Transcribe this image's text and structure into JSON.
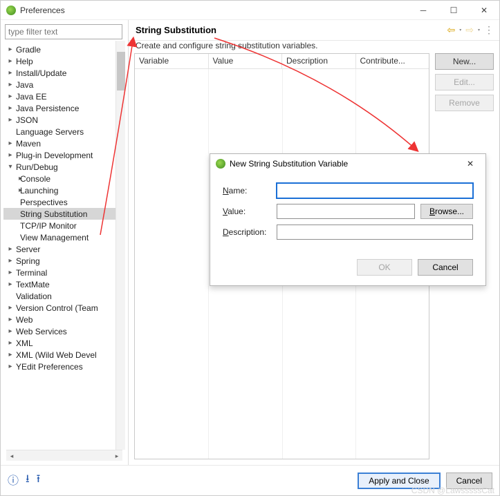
{
  "window": {
    "title": "Preferences"
  },
  "filter_placeholder": "type filter text",
  "tree": [
    {
      "label": "Gradle",
      "lvl": 0,
      "caret": "closed"
    },
    {
      "label": "Help",
      "lvl": 0,
      "caret": "closed"
    },
    {
      "label": "Install/Update",
      "lvl": 0,
      "caret": "closed"
    },
    {
      "label": "Java",
      "lvl": 0,
      "caret": "closed"
    },
    {
      "label": "Java EE",
      "lvl": 0,
      "caret": "closed"
    },
    {
      "label": "Java Persistence",
      "lvl": 0,
      "caret": "closed"
    },
    {
      "label": "JSON",
      "lvl": 0,
      "caret": "closed"
    },
    {
      "label": "Language Servers",
      "lvl": 0,
      "caret": "none"
    },
    {
      "label": "Maven",
      "lvl": 0,
      "caret": "closed"
    },
    {
      "label": "Plug-in Development",
      "lvl": 0,
      "caret": "closed"
    },
    {
      "label": "Run/Debug",
      "lvl": 0,
      "caret": "open"
    },
    {
      "label": "Console",
      "lvl": 1,
      "caret": "closed"
    },
    {
      "label": "Launching",
      "lvl": 1,
      "caret": "closed"
    },
    {
      "label": "Perspectives",
      "lvl": 1,
      "caret": "none"
    },
    {
      "label": "String Substitution",
      "lvl": 1,
      "caret": "none",
      "sel": true
    },
    {
      "label": "TCP/IP Monitor",
      "lvl": 1,
      "caret": "none"
    },
    {
      "label": "View Management",
      "lvl": 1,
      "caret": "none"
    },
    {
      "label": "Server",
      "lvl": 0,
      "caret": "closed"
    },
    {
      "label": "Spring",
      "lvl": 0,
      "caret": "closed"
    },
    {
      "label": "Terminal",
      "lvl": 0,
      "caret": "closed"
    },
    {
      "label": "TextMate",
      "lvl": 0,
      "caret": "closed"
    },
    {
      "label": "Validation",
      "lvl": 0,
      "caret": "none"
    },
    {
      "label": "Version Control (Team",
      "lvl": 0,
      "caret": "closed"
    },
    {
      "label": "Web",
      "lvl": 0,
      "caret": "closed"
    },
    {
      "label": "Web Services",
      "lvl": 0,
      "caret": "closed"
    },
    {
      "label": "XML",
      "lvl": 0,
      "caret": "closed"
    },
    {
      "label": "XML (Wild Web Devel",
      "lvl": 0,
      "caret": "closed"
    },
    {
      "label": "YEdit Preferences",
      "lvl": 0,
      "caret": "closed"
    }
  ],
  "page": {
    "title": "String Substitution",
    "description": "Create and configure string substitution variables.",
    "columns": [
      "Variable",
      "Value",
      "Description",
      "Contribute..."
    ],
    "buttons": {
      "new": "New...",
      "edit": "Edit...",
      "remove": "Remove"
    }
  },
  "footer": {
    "apply": "Apply and Close",
    "cancel": "Cancel"
  },
  "dialog": {
    "title": "New String Substitution Variable",
    "labels": {
      "name": "Name:",
      "value": "Value:",
      "description": "Description:"
    },
    "browse": "Browse...",
    "ok": "OK",
    "cancel": "Cancel",
    "name_value": "",
    "value_value": "",
    "desc_value": ""
  },
  "watermark": "CSDN @LawsssssCat"
}
